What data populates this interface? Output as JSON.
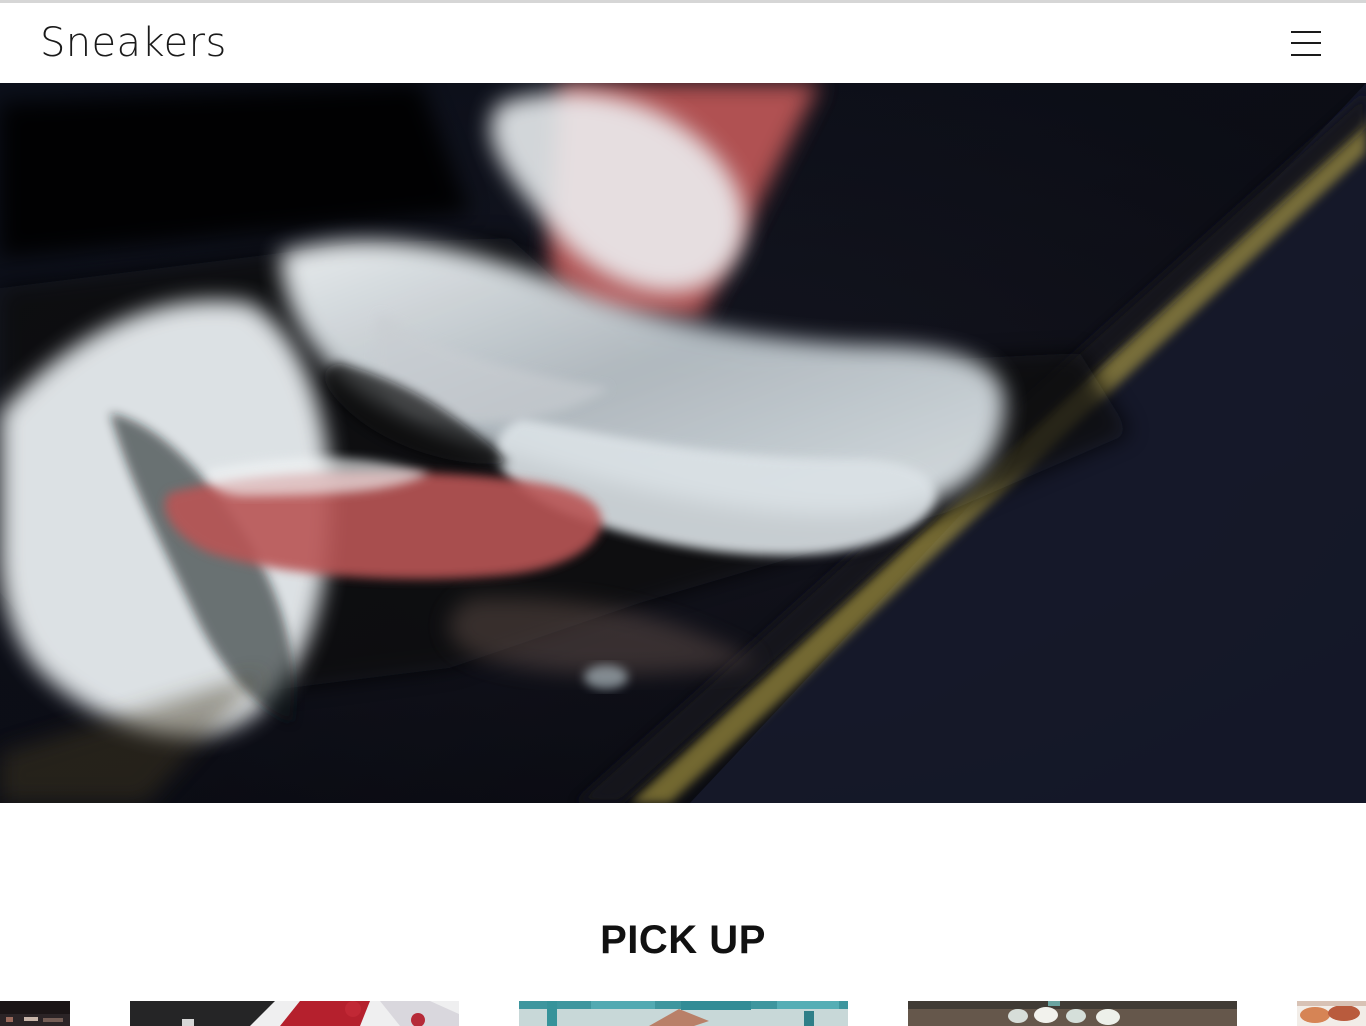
{
  "header": {
    "logo_text": "Sneakers",
    "menu_icon": "hamburger-menu-icon"
  },
  "hero": {
    "image": "blurred-sneaker-step-photo"
  },
  "pickup": {
    "title": "PICK UP",
    "cards": [
      {
        "image": "partial-sneaker-shelf-photo"
      },
      {
        "image": "red-white-sneaker-photo"
      },
      {
        "image": "teal-crate-hand-photo"
      },
      {
        "image": "sneakers-on-carpet-photo"
      },
      {
        "image": "partial-orange-sneaker-photo"
      }
    ]
  },
  "colors": {
    "text": "#111111",
    "header_background": "#ffffff",
    "hero_shadow": "#0d0d14",
    "hero_red_accent": "#b95555",
    "hero_yellow_stripe": "#c7b34a"
  }
}
